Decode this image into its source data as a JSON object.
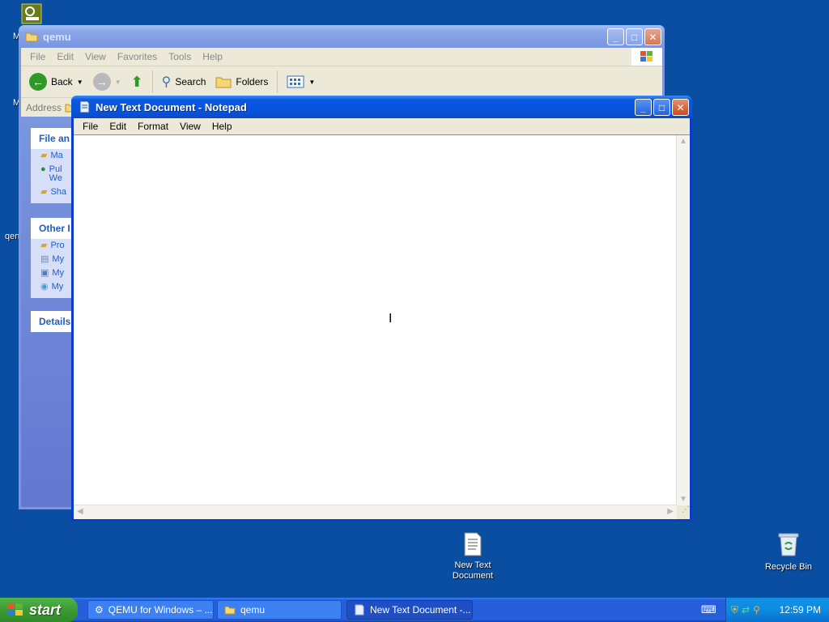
{
  "desktop": {
    "partial_labels": [
      "M",
      "M",
      "qen"
    ],
    "icons": {
      "new_text_document": {
        "line1": "New Text",
        "line2": "Document"
      },
      "recycle_bin": {
        "label": "Recycle Bin"
      }
    }
  },
  "explorer": {
    "title": "qemu",
    "menu": [
      "File",
      "Edit",
      "View",
      "Favorites",
      "Tools",
      "Help"
    ],
    "toolbar": {
      "back": "Back",
      "search": "Search",
      "folders": "Folders"
    },
    "address_label": "Address",
    "taskpane": {
      "file_tasks_header": "File an",
      "file_tasks": [
        "Ma",
        "Pul",
        "We",
        "Sha"
      ],
      "other_places_header": "Other I",
      "other_places": [
        "Pro",
        "My",
        "My",
        "My"
      ],
      "details_header": "Details"
    }
  },
  "notepad": {
    "title": "New Text Document - Notepad",
    "menu": [
      "File",
      "Edit",
      "Format",
      "View",
      "Help"
    ],
    "content": ""
  },
  "taskbar": {
    "start_label": "start",
    "tasks": [
      "QEMU for Windows – ...",
      "qemu",
      "New Text Document -..."
    ],
    "clock": "12:59 PM"
  },
  "colors": {
    "desktop": "#0a4ea1",
    "title_active": "#0854dc",
    "taskbar": "#245edb",
    "start": "#3c9a34"
  }
}
